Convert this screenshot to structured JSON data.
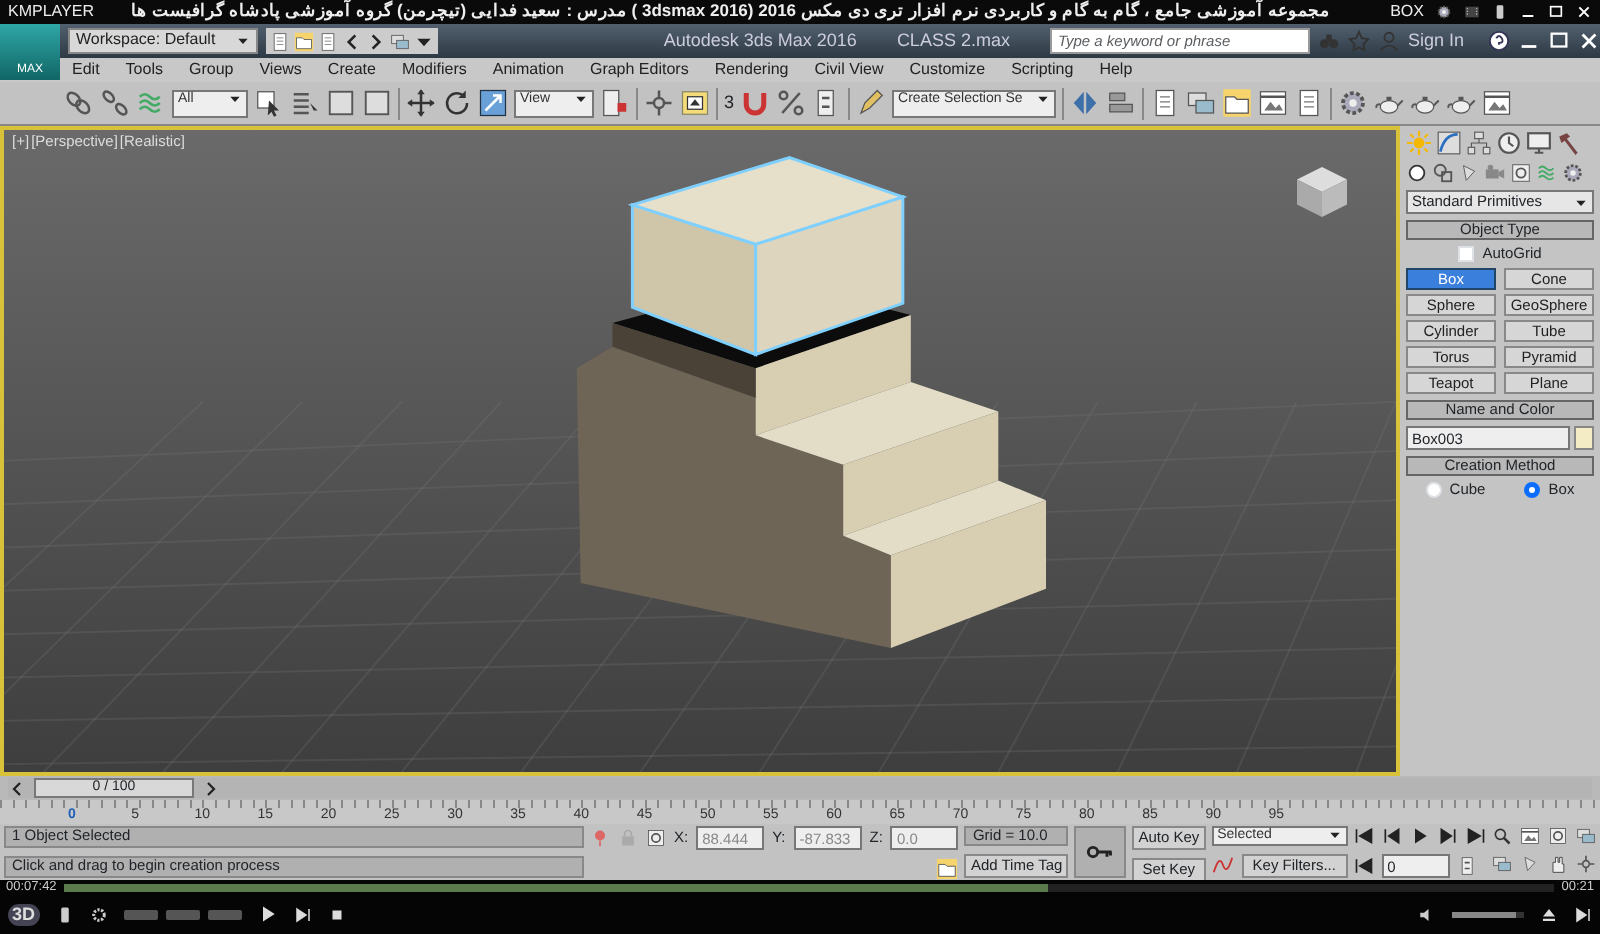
{
  "player": {
    "brand": "KMPLAYER",
    "title": "مجموعه آموزشی جامع ، گام به گام و کاربردی نرم افزار تری دی مکس 2016 (3dsmax 2016 ) مدرس : سعید فدایی (تیچرمن) گروه آموزشی پادشاه گرافیست ها",
    "badge": "BOX",
    "elapsed": "00:07:42",
    "duration": "00:21",
    "progress": {
      "level": 0.66
    },
    "mode": "3D",
    "volume": {
      "level": 0.9
    }
  },
  "max": {
    "logo": "MAX",
    "workspace": "Workspace: Default",
    "app_title": "Autodesk 3ds Max 2016",
    "file": "CLASS 2.max",
    "search": {
      "placeholder": "Type a keyword or phrase"
    },
    "sign_in": "Sign In",
    "menu": [
      "Edit",
      "Tools",
      "Group",
      "Views",
      "Create",
      "Modifiers",
      "Animation",
      "Graph Editors",
      "Rendering",
      "Civil View",
      "Customize",
      "Scripting",
      "Help"
    ],
    "toolbar": {
      "selection_filter": "All",
      "coord_system": "View",
      "named_selection": "Create Selection Se",
      "snap_label": "3"
    }
  },
  "viewport": {
    "labels": [
      "[+]",
      "[Perspective]",
      "[Realistic]"
    ]
  },
  "command_panel": {
    "category": "Standard Primitives",
    "object_type": {
      "title": "Object Type",
      "autogrid": {
        "label": "AutoGrid",
        "checked": false
      },
      "buttons": [
        {
          "label": "Box",
          "selected": true
        },
        {
          "label": "Cone",
          "selected": false
        },
        {
          "label": "Sphere",
          "selected": false
        },
        {
          "label": "GeoSphere",
          "selected": false
        },
        {
          "label": "Cylinder",
          "selected": false
        },
        {
          "label": "Tube",
          "selected": false
        },
        {
          "label": "Torus",
          "selected": false
        },
        {
          "label": "Pyramid",
          "selected": false
        },
        {
          "label": "Teapot",
          "selected": false
        },
        {
          "label": "Plane",
          "selected": false
        }
      ]
    },
    "name_and_color": {
      "title": "Name and Color",
      "name": "Box003",
      "color": "#f3ecc4"
    },
    "creation_method": {
      "title": "Creation Method",
      "options": [
        {
          "label": "Cube",
          "selected": false
        },
        {
          "label": "Box",
          "selected": true
        }
      ]
    }
  },
  "time_slider": {
    "position": "0 / 100",
    "level": 0
  },
  "track": {
    "ticks": [
      "0",
      "5",
      "10",
      "15",
      "20",
      "25",
      "30",
      "35",
      "40",
      "45",
      "50",
      "55",
      "60",
      "65",
      "70",
      "75",
      "80",
      "85",
      "90",
      "95"
    ]
  },
  "status": {
    "selection": "1 Object Selected",
    "prompt": "Click and drag to begin creation process",
    "coords": [
      {
        "label": "X:",
        "value": "88.444"
      },
      {
        "label": "Y:",
        "value": "-87.833"
      },
      {
        "label": "Z:",
        "value": "0.0"
      }
    ],
    "grid": "Grid = 10.0",
    "time_tag": "Add Time Tag",
    "auto_key": "Auto Key",
    "set_key": "Set Key",
    "key_mode": "Selected",
    "key_filters": "Key Filters...",
    "frame": "0"
  }
}
